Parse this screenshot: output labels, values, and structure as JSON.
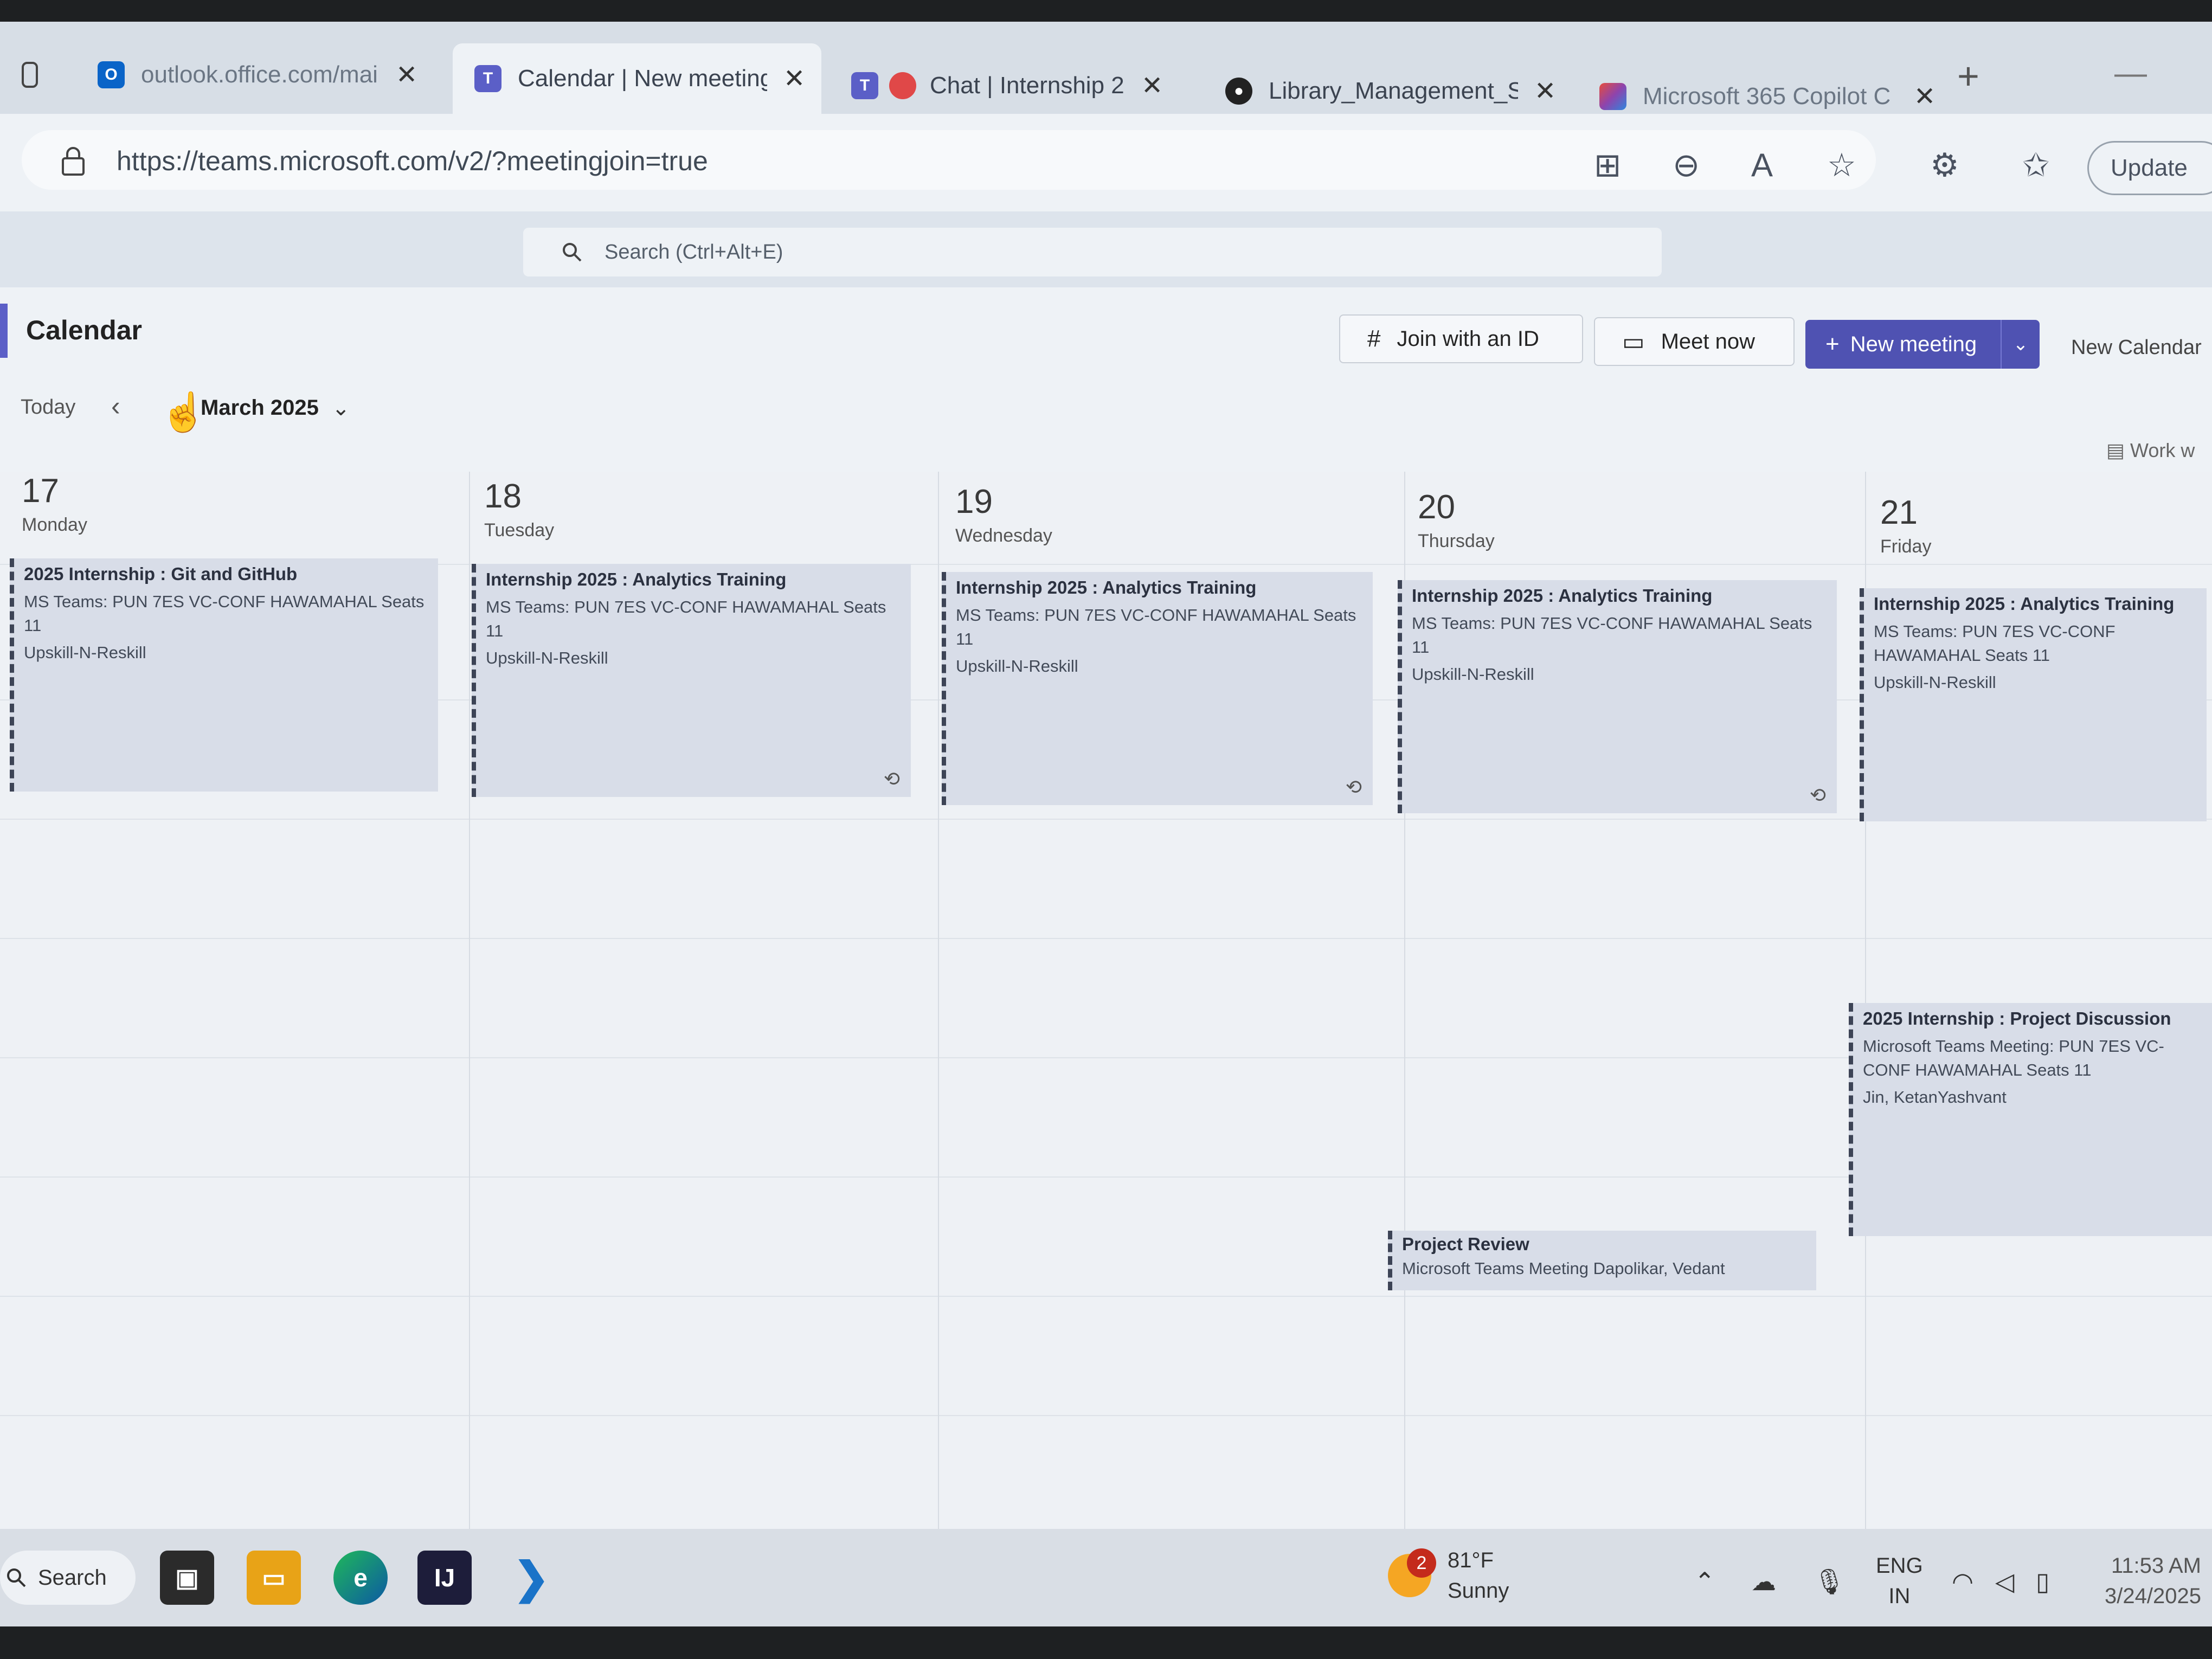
{
  "browser": {
    "tabs": [
      {
        "label": "outlook.office.com/mail",
        "icon": "outlook-icon",
        "active": false
      },
      {
        "label": "Calendar | New meeting",
        "icon": "teams-icon",
        "active": true
      },
      {
        "label": "Chat | Internship 2",
        "icon": "teams-icon",
        "active": false
      },
      {
        "label": "Library_Management_S",
        "icon": "github-icon",
        "active": false
      },
      {
        "label": "Microsoft 365 Copilot C",
        "icon": "copilot-icon",
        "active": false
      }
    ],
    "new_tab": "+",
    "url": "https://teams.microsoft.com/v2/?meetingjoin=true",
    "update_label": "Update"
  },
  "teams": {
    "search_placeholder": "Search (Ctrl+Alt+E)"
  },
  "calendar": {
    "title": "Calendar",
    "join_with_id": "Join with an ID",
    "meet_now": "Meet now",
    "new_meeting": "New meeting",
    "new_calendar": "New Calendar",
    "today": "Today",
    "month": "March 2025",
    "view": "Work w",
    "days": [
      {
        "num": "17",
        "name": "Monday"
      },
      {
        "num": "18",
        "name": "Tuesday"
      },
      {
        "num": "19",
        "name": "Wednesday"
      },
      {
        "num": "20",
        "name": "Thursday"
      },
      {
        "num": "21",
        "name": "Friday"
      }
    ],
    "events": [
      {
        "title": "2025 Internship : Git and GitHub",
        "location": "MS Teams: PUN 7ES VC-CONF HAWAMAHAL Seats 11",
        "tag": "Upskill-N-Reskill"
      },
      {
        "title": "Internship 2025 : Analytics Training",
        "location": "MS Teams: PUN 7ES VC-CONF HAWAMAHAL Seats 11",
        "tag": "Upskill-N-Reskill"
      },
      {
        "title": "Internship 2025 : Analytics Training",
        "location": "MS Teams: PUN 7ES VC-CONF HAWAMAHAL Seats 11",
        "tag": "Upskill-N-Reskill"
      },
      {
        "title": "Internship 2025 : Analytics Training",
        "location": "MS Teams: PUN 7ES VC-CONF HAWAMAHAL Seats 11",
        "tag": "Upskill-N-Reskill"
      },
      {
        "title": "Internship 2025 : Analytics Training",
        "location": "MS Teams: PUN 7ES VC-CONF HAWAMAHAL Seats 11",
        "tag": "Upskill-N-Reskill"
      },
      {
        "title": "2025 Internship : Project Discussion",
        "location": "Microsoft Teams Meeting: PUN 7ES VC-CONF HAWAMAHAL Seats 11",
        "tag": "Jin, KetanYashvant"
      },
      {
        "title": "Project Review",
        "location": "Microsoft Teams Meeting  Dapolikar, Vedant",
        "tag": ""
      }
    ]
  },
  "taskbar": {
    "search": "Search",
    "weather_badge": "2",
    "temperature": "81°F",
    "condition": "Sunny",
    "lang1": "ENG",
    "lang2": "IN",
    "time": "11:53 AM",
    "date": "3/24/2025"
  },
  "colors": {
    "accent": "#4f52b2",
    "event_bg": "#d8dde8",
    "event_border": "#3d4456"
  }
}
